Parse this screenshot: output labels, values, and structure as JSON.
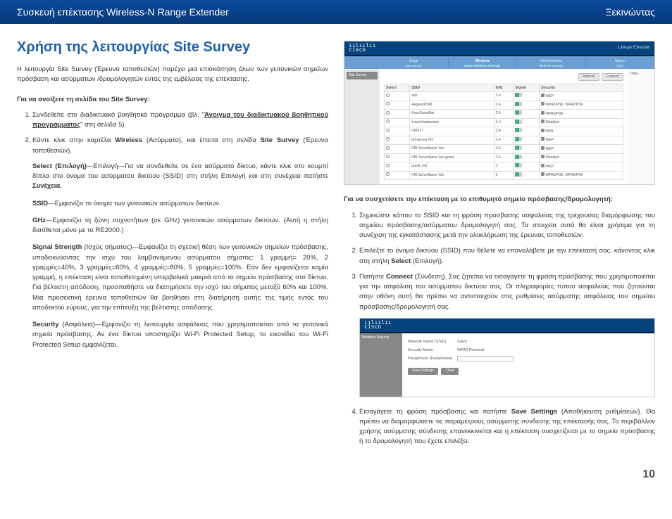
{
  "topbar": {
    "left": "Συσκευή επέκτασης Wireless-N Range Extender",
    "right": "Ξεκινώντας"
  },
  "h1": "Χρήση της λειτουργίας Site Survey",
  "intro": "Η λειτουργία Site Survey (Έρευνα τοποθεσιών) παρέχει μια επισκόπηση όλων των γειτονικών σημείων πρόσβαση και ασύρματων /δρομολογητών εντός της εμβέλειας της επέκτασης.",
  "subheadL": "Για να ανοίξετε τη σελίδα του Site Survey:",
  "stepsL": {
    "s1a": "Συνδεθείτε στο διαδικτυακό βοηθητικό πρόγραμμα (βλ. \"",
    "s1link": "Άνοιγμα του διαδικτυακού βοηθητικού προγράμματος",
    "s1b": "\" στη σελίδα 5).",
    "s2a": "Κάντε κλικ στην καρτέλα ",
    "s2b1": "Wireless",
    "s2c": " (Ασύρματο), και έπειτα στη σελίδα ",
    "s2b2": "Site Survey",
    "s2d": " (Έρευνα τοποθεσιών)."
  },
  "defs": {
    "select_b": "Select (Επιλογή)",
    "select_t": "—Επιλογή—Για να συνδεθείτε σε ένα ασύρματο δίκτυο, κάντε κλικ στο κουμπί δίπλα στο όνομα του ασύρματου δικτύου (SSID) στη στήλη Επιλογή και στη συνέχεια πατήστε ",
    "select_b2": "Συνέχεια",
    "select_t2": ".",
    "ssid_b": "SSID",
    "ssid_t": "—Εμφανίζει το όνομα των γειτονικών ασύρματων δικτύων.",
    "ghz_b": "GHz",
    "ghz_t": "—Εμφανίζει τη ζώνη συχνοτήτων (σε GHz) γειτονικών ασύρματων δικτύων. (Αυτή η στήλη διατίθεται μόνο με το RE2000.)",
    "sig_b": "Signal Strength",
    "sig_t": " (Ισχύς σήματος)—Εμφανίζει τη σχετική θέση των γειτονικών σημείων πρόσβασης, υποδεικνύοντας την ισχύ του λαμβανόμενου ασύρματου σήματος: 1 γραμμή= 20%, 2 γραμμές=40%, 3 γραμμές=60%, 4 γραμμές=80%, 5 γραμμές=100%. Εάν δεν εμφανίζεται καμία γραμμή, η επέκταση είναι τοποθετημένη υπερβολικά μακριά από το σημείο πρόσβασης στο δίκτυο. Για βέλτιστη απόδοση, προσπαθήστε να διατηρήσετε την ισχύ του σήματος μεταξύ 60% και 100%. Μια προσεκτική έρευνα τοποθεσιών θα βοηθήσει στη διατήρηση αυτής της τιμής εντός του αποδεκτού εύρους, για την επίτευξη της βέλτιστης απόδοσης.",
    "sec_b": "Security",
    "sec_t": " (Ασφάλεια)—Εμφανίζει τη λειτουργία ασφάλειας που χρησιμοποιείται από τα γειτονικά σημεία πρόσβασης. Αν ένα δίκτυο υποστηρίζει Wi-Fi Protected Setup, το εικονίδιο του Wi-Fi Protected Setup εμφανίζεται."
  },
  "fig1": {
    "brand": "cisco",
    "title": "Linksys Extender",
    "nav": [
      "Setup",
      "Wireless",
      "Administration",
      "Status"
    ],
    "subnav": [
      "Site Survey",
      "Basic Wireless Settings",
      "Wireless Security",
      "QoS"
    ],
    "side": "Site Survey",
    "btn1": "Refresh",
    "btn2": "Connect",
    "help": "Help...",
    "th": [
      "Select",
      "SSID",
      "GHz",
      "Signal",
      "Security"
    ],
    "rows": [
      [
        "",
        "adz",
        "2.4",
        "",
        "WEP"
      ],
      [
        "",
        "AegeanP298",
        "2.4",
        "",
        "WPA2/PSK, WPA2/PSK"
      ],
      [
        "",
        "KozyGuestNet",
        "2.4",
        "",
        "WPA2/PSK"
      ],
      [
        "",
        "KozyInfastructure",
        "2.4",
        "",
        "Disabled"
      ],
      [
        "",
        "DMX17",
        "2.4",
        "",
        "WPA"
      ],
      [
        "",
        "temporary742",
        "2.4",
        "",
        "WEP"
      ],
      [
        "",
        "FBI Surveillance Van",
        "2.4",
        "",
        "WEP"
      ],
      [
        "",
        "FBI Surveillance Van guest",
        "2.4",
        "",
        "Disabled"
      ],
      [
        "",
        "guest_net",
        "2",
        "",
        "WEP"
      ],
      [
        "",
        "FBI Surveillance Van",
        "2",
        "",
        "WPA2/PSK, WPA2/PSK"
      ]
    ]
  },
  "subheadR": "Για να συσχετίσετε την επέκταση με το επιθυμητό σημείο πρόσβασης/δρομολογητή:",
  "stepsR": {
    "s1": "Σημειώστε κάπου το SSID και τη φράση πρόσβασης ασφαλείας της τρέχουσας διαμόρφωσης του σημείου πρόσβασης/ασύρματου δρομολογητή σας. Τα στοιχεία αυτά θα είναι χρήσιμα για τη συνέχιση της εγκατάστασης μετά την ολοκλήρωση της έρευνας τοποθεσιών.",
    "s2a": "Επιλέξτε το όνομα δικτύου (SSID) που θέλετε να επαναλάβετε με την επέκτασή σας, κάνοντας κλικ στη στήλη ",
    "s2b": "Select",
    "s2c": " (Επιλογή).",
    "s3a": "Πατήστε ",
    "s3b": "Connect",
    "s3c": " (Σύνδεση). Σας ζητείται να εισαγάγετε τη φράση πρόσβασης που χρησιμοποιείται για την ασφάλιση του ασύρματου δικτύου σας. Οι πληροφορίες τύπου ασφαλείας που ζητούνται στην οθόνη αυτή θα πρέπει να αντιστοιχούν στις ρυθμίσεις ασύρματης ασφάλειας του σημείου πρόσβασης/δρομολογητή σας."
  },
  "fig2": {
    "brand": "cisco",
    "side": "Wireless Security",
    "r1l": "Network Name (SSID):",
    "r1v": "Salvo",
    "r2l": "Security Mode:",
    "r2v": "WPA2 Personal",
    "r3l": "Passphrase (Passphrase):",
    "btn1": "Save Settings",
    "btn2": "Close"
  },
  "step4a": "Εισαγάγετε τη φράση πρόσβασης και πατήστε ",
  "step4b": "Save Settings",
  "step4c": " (Αποθήκευση ρυθμίσεων). Θα πρέπει να διαμορφώσετε τις παραμέτρους ασύρματης σύνδεσης της επέκτασής σας. Το περιβάλλον χρήσης ασύρματης σύνδεσης επανεκκινείται και η επέκταση συσχετίζεται με το σημείο πρόσβασης ή το δρομολογητή που έχετε επιλέξει.",
  "page_num": "10"
}
